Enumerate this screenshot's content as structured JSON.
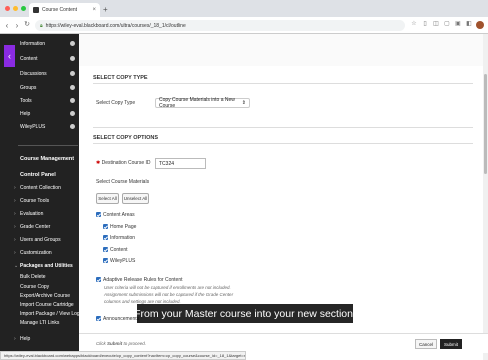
{
  "browser": {
    "tab_title": "Course Content",
    "url": "https://wiley-eval.blackboard.com/ultra/courses/_18_1/cl/outline",
    "status_url": "https://wiley-eval.blackboard.com/webapps/blackboard/execute/cp_copy_content?navItem=cp_copy_course&course_id=_18_1&target=null"
  },
  "sidebar": {
    "top_items": [
      {
        "label": "Information"
      },
      {
        "label": "Content"
      },
      {
        "label": "Discussions"
      },
      {
        "label": "Groups"
      },
      {
        "label": "Tools"
      },
      {
        "label": "Help"
      },
      {
        "label": "WileyPLUS"
      }
    ],
    "course_management": "Course Management",
    "control_panel": "Control Panel",
    "cp_items": [
      {
        "label": "Content Collection"
      },
      {
        "label": "Course Tools"
      },
      {
        "label": "Evaluation"
      },
      {
        "label": "Grade Center"
      },
      {
        "label": "Users and Groups"
      },
      {
        "label": "Customization"
      },
      {
        "label": "Packages and Utilities"
      }
    ],
    "pu_items": [
      {
        "label": "Bulk Delete"
      },
      {
        "label": "Course Copy"
      },
      {
        "label": "Export/Archive Course"
      },
      {
        "label": "Import Course Cartridge"
      },
      {
        "label": "Import Package / View Logs"
      },
      {
        "label": "Manage LTI Links"
      }
    ],
    "help": "Help"
  },
  "main": {
    "select_copy_type_heading": "SELECT COPY TYPE",
    "select_copy_type_label": "Select Copy Type",
    "copy_type_value": "Copy Course Materials into a New Course",
    "select_copy_options_heading": "SELECT COPY OPTIONS",
    "destination_label": "Destination Course ID",
    "destination_value": "TC324",
    "select_materials_label": "Select Course Materials",
    "select_all": "Select All",
    "unselect_all": "Unselect All",
    "content_areas": "Content Areas",
    "content_items": [
      "Home Page",
      "Information",
      "Content",
      "WileyPLUS"
    ],
    "adaptive_release": "Adaptive Release Rules for Content",
    "adaptive_note_1": "User criteria will not be captured if enrollments are not included.",
    "adaptive_note_2": "Assignment submissions will not be captured if the Grade Center",
    "adaptive_note_3": "columns and settings are not included.",
    "announcements": "Announcements"
  },
  "footer": {
    "note_prefix": "Click ",
    "note_bold": "Submit",
    "note_suffix": " to proceed.",
    "cancel": "Cancel",
    "submit": "Submit"
  },
  "caption": "From your Master course into your new section.",
  "colors": {
    "accent_purple": "#8a2be2",
    "checkbox_blue": "#2c6dbd",
    "sidebar_bg": "#222222"
  }
}
